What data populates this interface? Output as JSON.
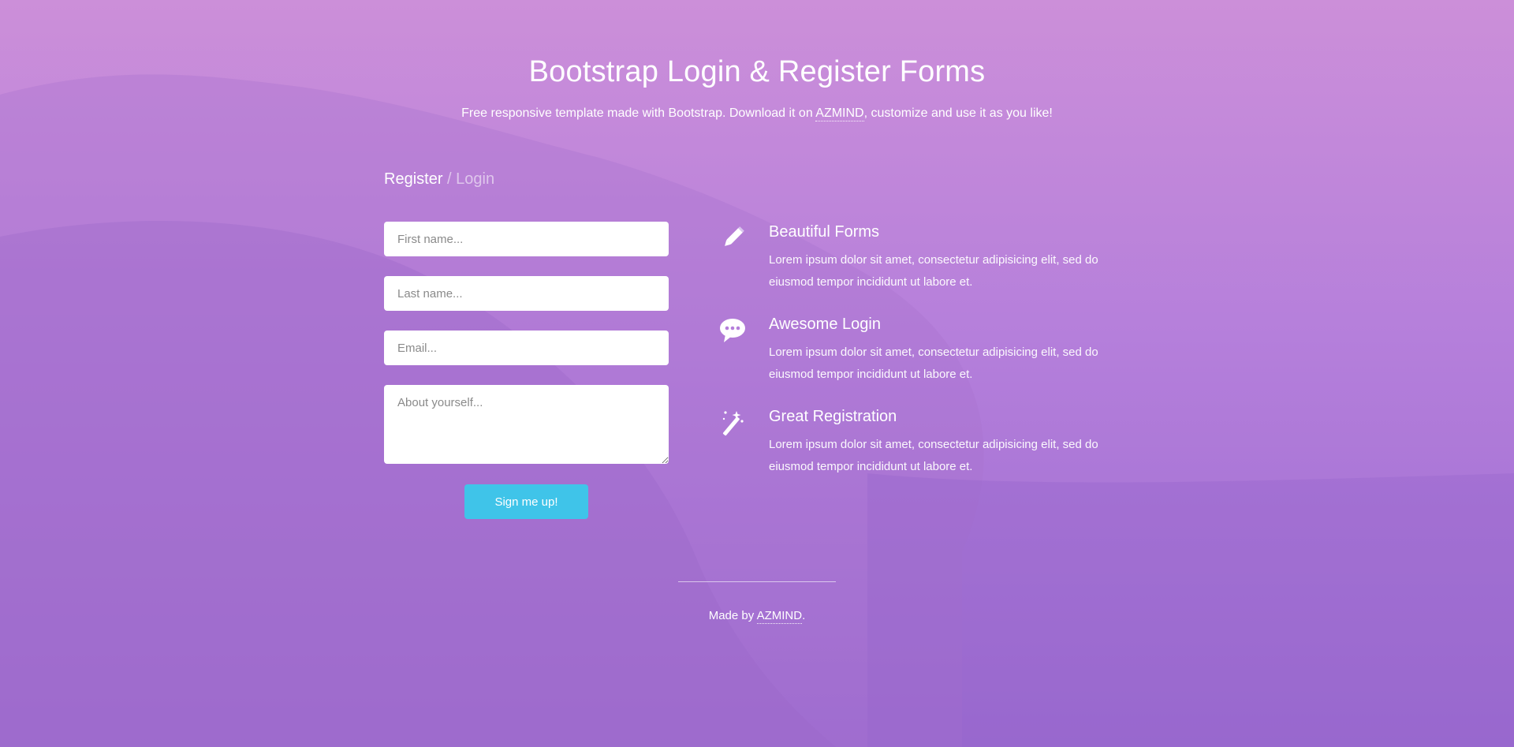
{
  "header": {
    "title": "Bootstrap Login & Register Forms",
    "description_before": "Free responsive template made with Bootstrap. Download it on ",
    "description_link": "AZMIND",
    "description_after": ", customize and use it as you like!"
  },
  "form": {
    "title_active": "Register",
    "title_separator": " / ",
    "title_inactive": "Login",
    "fields": {
      "first_name_placeholder": "First name...",
      "last_name_placeholder": "Last name...",
      "email_placeholder": "Email...",
      "about_placeholder": "About yourself..."
    },
    "submit_label": "Sign me up!"
  },
  "features": [
    {
      "icon": "pencil-icon",
      "title": "Beautiful Forms",
      "text": "Lorem ipsum dolor sit amet, consectetur adipisicing elit, sed do eiusmod tempor incididunt ut labore et."
    },
    {
      "icon": "chat-bubble-icon",
      "title": "Awesome Login",
      "text": "Lorem ipsum dolor sit amet, consectetur adipisicing elit, sed do eiusmod tempor incididunt ut labore et."
    },
    {
      "icon": "magic-wand-icon",
      "title": "Great Registration",
      "text": "Lorem ipsum dolor sit amet, consectetur adipisicing elit, sed do eiusmod tempor incididunt ut labore et."
    }
  ],
  "footer": {
    "prefix": "Made by ",
    "link": "AZMIND",
    "suffix": "."
  },
  "colors": {
    "background_top": "#cc8fd9",
    "background_bottom": "#9a6ad0",
    "button": "#3fc4e9",
    "text": "#ffffff"
  }
}
